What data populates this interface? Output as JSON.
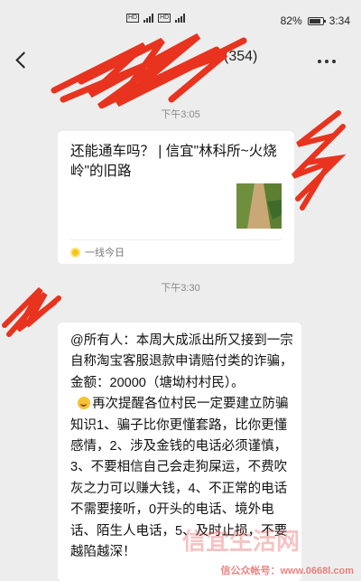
{
  "status_bar": {
    "battery": "82%",
    "time": "3:34",
    "hd1": "HD",
    "hd2": "HD"
  },
  "nav": {
    "title": "(354)"
  },
  "messages": [
    {
      "time": "下午3:05"
    },
    {
      "time": "下午3:30"
    }
  ],
  "card": {
    "title": "还能通车吗？ | 信宜\"林科所~火烧岭\"的旧路",
    "source": "一线今日"
  },
  "bubble": {
    "text_1": "@所有人：本周大成派出所又接到一宗自称淘宝客服退款申请赔付类的诈骗，金额：20000（塘坳村村民）。\n  ",
    "text_2": "再次提醒各位村民一定要建立防骗知识1、骗子比你更懂套路，比你更懂感情，2、涉及金钱的电话必须谨慎，3、不要相信自己会走狗屎运，不费吹灰之力可以赚大钱，4、不正常的电话不需要接听，0开头的电话、境外电话、陌生人电话，5、及时止损，不要越陷越深！"
  },
  "watermark": {
    "line": "信公众帐号：www.0668l.com"
  },
  "colors": {
    "background": "#ededed",
    "scribble": "#e8331f"
  }
}
